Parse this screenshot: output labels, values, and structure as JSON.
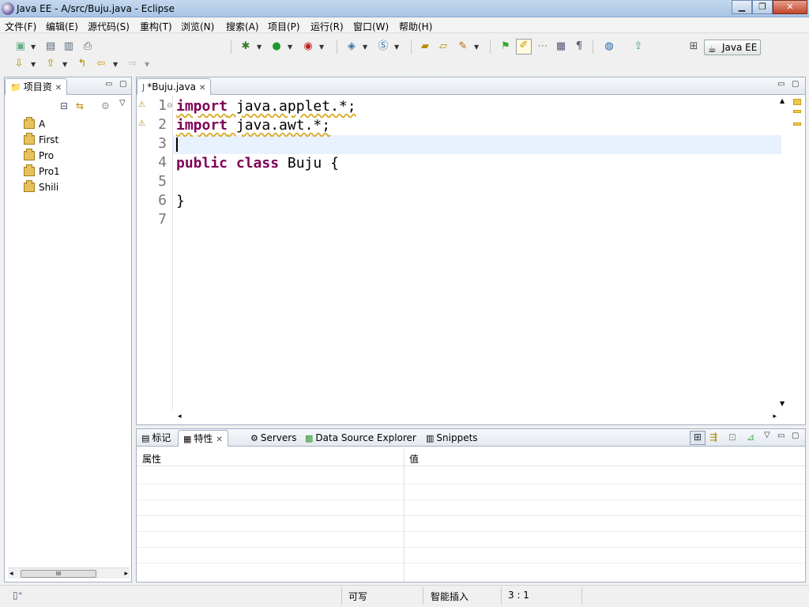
{
  "window": {
    "title": "Java EE  -  A/src/Buju.java  -  Eclipse",
    "controls": [
      "minimize",
      "maximize",
      "close"
    ]
  },
  "menu": [
    "文件(F)",
    "编辑(E)",
    "源代码(S)",
    "重构(T)",
    "浏览(N)",
    "搜索(A)",
    "项目(P)",
    "运行(R)",
    "窗口(W)",
    "帮助(H)"
  ],
  "toolbar": {
    "perspective_label": "Java EE"
  },
  "project_explorer": {
    "tab_label": "项目资",
    "projects": [
      "A",
      "First",
      "Pro",
      "Pro1",
      "Shili"
    ]
  },
  "editor": {
    "tab_label": "*Buju.java",
    "line_numbers": [
      "1",
      "2",
      "3",
      "4",
      "5",
      "6",
      "7"
    ],
    "lines": [
      {
        "kw": "import",
        "rest": " java.applet.*;"
      },
      {
        "kw": "import",
        "rest": " java.awt.*;"
      },
      {
        "kw": "",
        "rest": ""
      },
      {
        "kw": "public class",
        "rest": " Buju {"
      },
      {
        "kw": "",
        "rest": ""
      },
      {
        "kw": "",
        "rest": "}"
      },
      {
        "kw": "",
        "rest": ""
      }
    ],
    "cursor_line": 3
  },
  "bottom_panel": {
    "tabs": [
      "标记",
      "特性",
      "Servers",
      "Data Source Explorer",
      "Snippets"
    ],
    "active_tab": "特性",
    "columns": [
      "属性",
      "值"
    ]
  },
  "status": {
    "writable": "可写",
    "insert_mode": "智能插入",
    "position": "3 : 1"
  },
  "colors": {
    "keyword": "#7f0055",
    "current_line": "#e8f2fe",
    "line_number": "#787878"
  }
}
